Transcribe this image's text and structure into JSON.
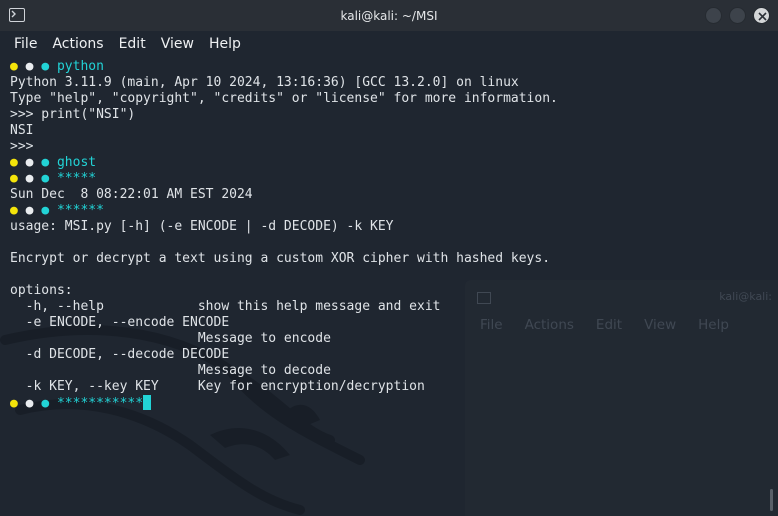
{
  "window": {
    "title": "kali@kali: ~/MSI",
    "accent": "#22d3d6",
    "prompt_colors": [
      "#f4e40a",
      "#e9ecef",
      "#22d3d6"
    ]
  },
  "menu": [
    "File",
    "Actions",
    "Edit",
    "View",
    "Help"
  ],
  "background_window": {
    "title": "kali@kali:",
    "menu": [
      "File",
      "Actions",
      "Edit",
      "View",
      "Help"
    ]
  },
  "terminal": {
    "prompt_dots": "●",
    "lines": [
      {
        "type": "prompt",
        "command": "python"
      },
      {
        "type": "out",
        "text": "Python 3.11.9 (main, Apr 10 2024, 13:16:36) [GCC 13.2.0] on linux"
      },
      {
        "type": "out",
        "text": "Type \"help\", \"copyright\", \"credits\" or \"license\" for more information."
      },
      {
        "type": "out",
        "text": ">>> print(\"NSI\")"
      },
      {
        "type": "out",
        "text": "NSI"
      },
      {
        "type": "out",
        "text": ">>>"
      },
      {
        "type": "prompt",
        "command": "ghost"
      },
      {
        "type": "prompt",
        "command": "*****"
      },
      {
        "type": "out",
        "text": "Sun Dec  8 08:22:01 AM EST 2024"
      },
      {
        "type": "prompt",
        "command": "******"
      },
      {
        "type": "out",
        "text": "usage: MSI.py [-h] (-e ENCODE | -d DECODE) -k KEY"
      },
      {
        "type": "out",
        "text": ""
      },
      {
        "type": "out",
        "text": "Encrypt or decrypt a text using a custom XOR cipher with hashed keys."
      },
      {
        "type": "out",
        "text": ""
      },
      {
        "type": "out",
        "text": "options:"
      },
      {
        "type": "out",
        "text": "  -h, --help            show this help message and exit"
      },
      {
        "type": "out",
        "text": "  -e ENCODE, --encode ENCODE"
      },
      {
        "type": "out",
        "text": "                        Message to encode"
      },
      {
        "type": "out",
        "text": "  -d DECODE, --decode DECODE"
      },
      {
        "type": "out",
        "text": "                        Message to decode"
      },
      {
        "type": "out",
        "text": "  -k KEY, --key KEY     Key for encryption/decryption"
      },
      {
        "type": "prompt",
        "command": "***********",
        "cursor": true
      }
    ]
  }
}
